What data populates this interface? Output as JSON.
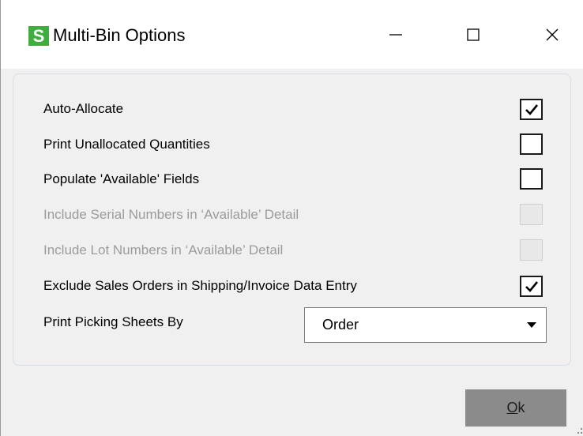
{
  "window": {
    "app_icon_letter": "S",
    "title": "Multi-Bin Options",
    "minimize_icon": "minimize-icon",
    "maximize_icon": "maximize-icon",
    "close_icon": "close-icon"
  },
  "options": [
    {
      "label": "Auto-Allocate",
      "checked": true,
      "enabled": true
    },
    {
      "label": "Print Unallocated Quantities",
      "checked": false,
      "enabled": true
    },
    {
      "label": "Populate 'Available' Fields",
      "checked": false,
      "enabled": true
    },
    {
      "label": "Include Serial Numbers in ‘Available’ Detail",
      "checked": false,
      "enabled": false
    },
    {
      "label": "Include Lot Numbers in ‘Available’ Detail",
      "checked": false,
      "enabled": false
    },
    {
      "label": "Exclude Sales Orders in Shipping/Invoice Data Entry",
      "checked": true,
      "enabled": true
    }
  ],
  "picking": {
    "label": "Print Picking Sheets By",
    "selected": "Order"
  },
  "footer": {
    "ok_mnemonic": "O",
    "ok_rest": "k"
  },
  "colors": {
    "brand": "#3fae3f",
    "ok_button": "#8b8b8b",
    "disabled_text": "#9b9b9b"
  }
}
